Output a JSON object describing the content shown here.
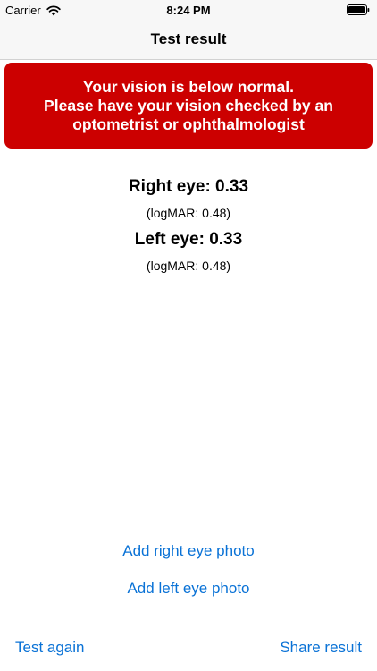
{
  "status_bar": {
    "carrier": "Carrier",
    "time": "8:24 PM",
    "icons": [
      "wifi-icon",
      "battery-icon"
    ]
  },
  "nav": {
    "title": "Test result"
  },
  "alert": {
    "line1": "Your vision is below normal.",
    "line2": "Please have your vision checked by an",
    "line3": "optometrist or ophthalmologist",
    "background_color": "#cc0000"
  },
  "results": {
    "right_eye": "Right eye: 0.33",
    "right_eye_logmar": "(logMAR:  0.48)",
    "left_eye": "Left eye: 0.33",
    "left_eye_logmar": "(logMAR:  0.48)"
  },
  "actions": {
    "add_right_eye_photo": "Add right eye photo",
    "add_left_eye_photo": "Add left eye photo",
    "test_again": "Test again",
    "share_result": "Share result",
    "link_color": "#0a72d6"
  }
}
